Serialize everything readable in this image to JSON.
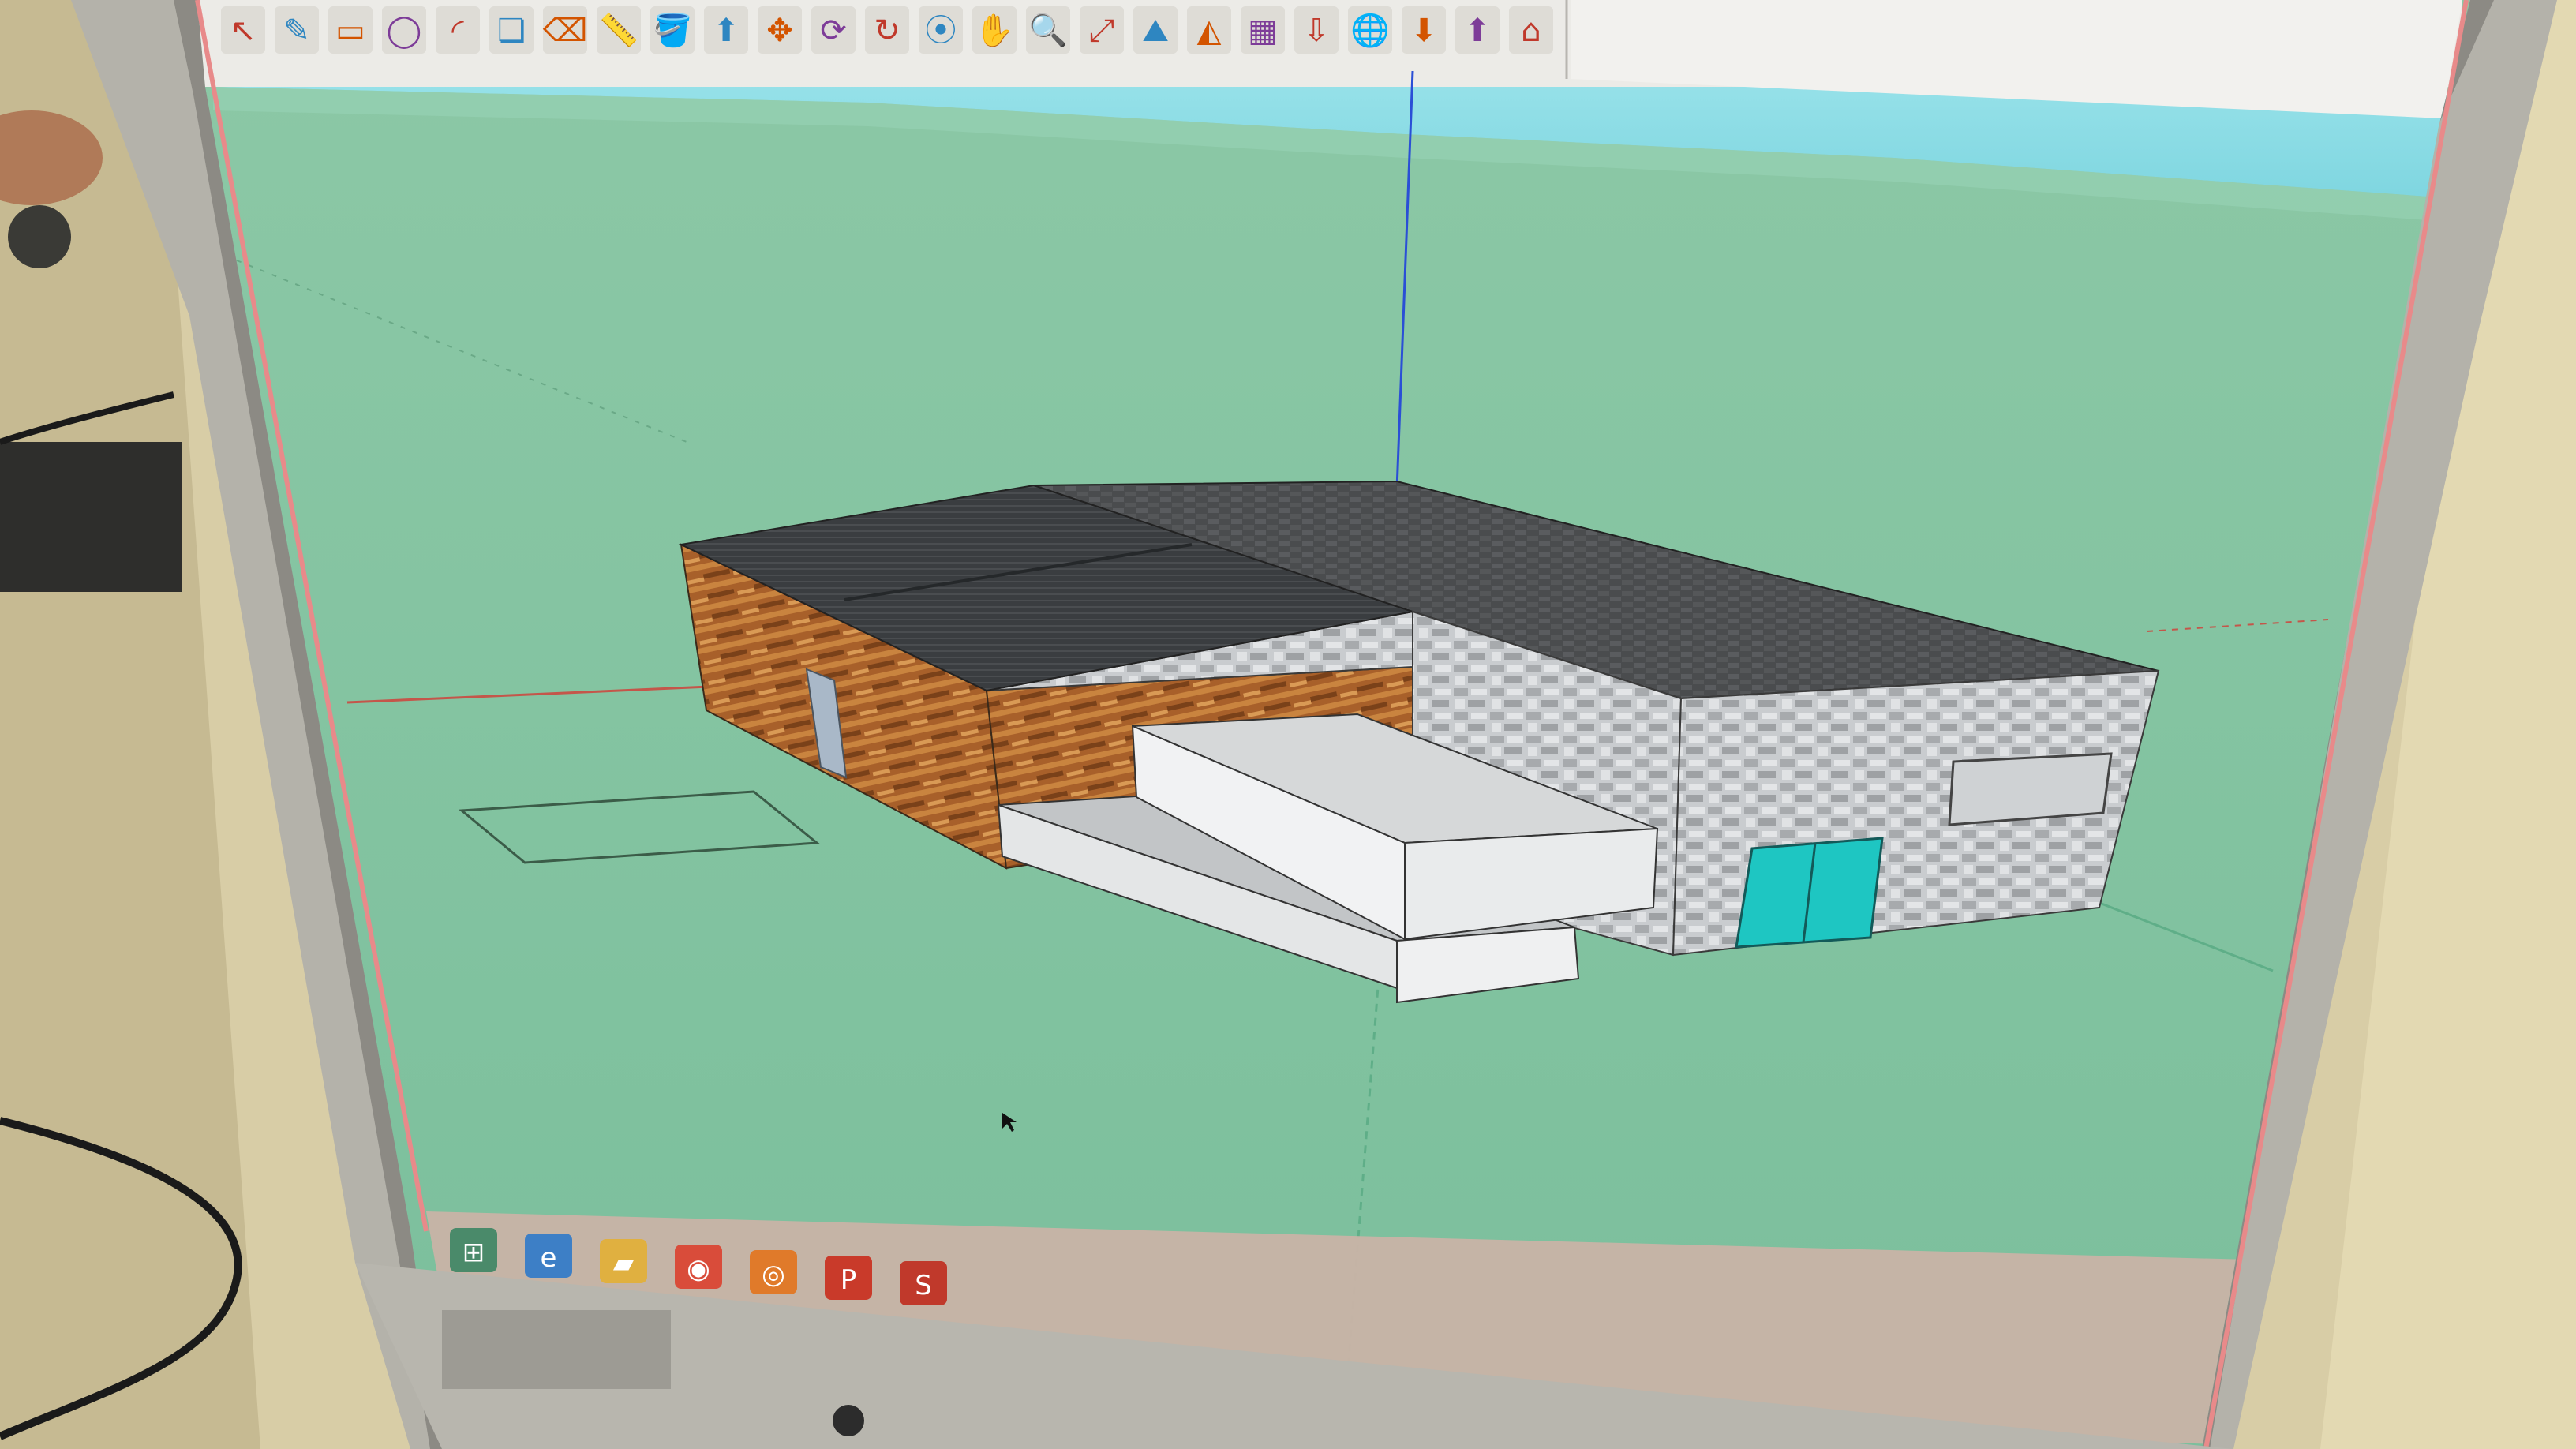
{
  "app": {
    "name": "SketchUp",
    "colors": {
      "sky": "#8fdde6",
      "ground": "#86c4a3",
      "accent_door": "#1ec6c2"
    }
  },
  "toolbar": {
    "items": [
      {
        "name": "select-tool-icon",
        "glyph": "↖"
      },
      {
        "name": "pencil-tool-icon",
        "glyph": "✎"
      },
      {
        "name": "rectangle-tool-icon",
        "glyph": "▭"
      },
      {
        "name": "circle-tool-icon",
        "glyph": "◯"
      },
      {
        "name": "arc-tool-icon",
        "glyph": "◜"
      },
      {
        "name": "make-component-icon",
        "glyph": "❏"
      },
      {
        "name": "eraser-tool-icon",
        "glyph": "⌫"
      },
      {
        "name": "tape-measure-icon",
        "glyph": "📏"
      },
      {
        "name": "paint-bucket-icon",
        "glyph": "🪣"
      },
      {
        "name": "push-pull-icon",
        "glyph": "⬆"
      },
      {
        "name": "move-tool-icon",
        "glyph": "✥"
      },
      {
        "name": "rotate-tool-icon",
        "glyph": "⟳"
      },
      {
        "name": "follow-me-icon",
        "glyph": "↻"
      },
      {
        "name": "orbit-tool-icon",
        "glyph": "⦿"
      },
      {
        "name": "pan-tool-icon",
        "glyph": "✋"
      },
      {
        "name": "zoom-tool-icon",
        "glyph": "🔍"
      },
      {
        "name": "zoom-extents-icon",
        "glyph": "⤢"
      },
      {
        "name": "add-location-icon",
        "glyph": "⛰"
      },
      {
        "name": "toggle-terrain-icon",
        "glyph": "◭"
      },
      {
        "name": "photo-textures-icon",
        "glyph": "▦"
      },
      {
        "name": "place-model-icon",
        "glyph": "⇩"
      },
      {
        "name": "google-earth-icon",
        "glyph": "🌐"
      },
      {
        "name": "get-models-icon",
        "glyph": "⬇"
      },
      {
        "name": "share-model-icon",
        "glyph": "⬆"
      },
      {
        "name": "warehouse-icon",
        "glyph": "⌂"
      }
    ]
  },
  "taskbar": {
    "items": [
      {
        "name": "start-button-icon",
        "glyph": "⊞"
      },
      {
        "name": "internet-explorer-icon",
        "glyph": "e"
      },
      {
        "name": "file-explorer-icon",
        "glyph": "▰"
      },
      {
        "name": "chrome-icon",
        "glyph": "◉"
      },
      {
        "name": "firefox-icon",
        "glyph": "◎"
      },
      {
        "name": "powerpoint-icon",
        "glyph": "P"
      },
      {
        "name": "sketchup-taskbar-icon",
        "glyph": "S"
      }
    ]
  }
}
